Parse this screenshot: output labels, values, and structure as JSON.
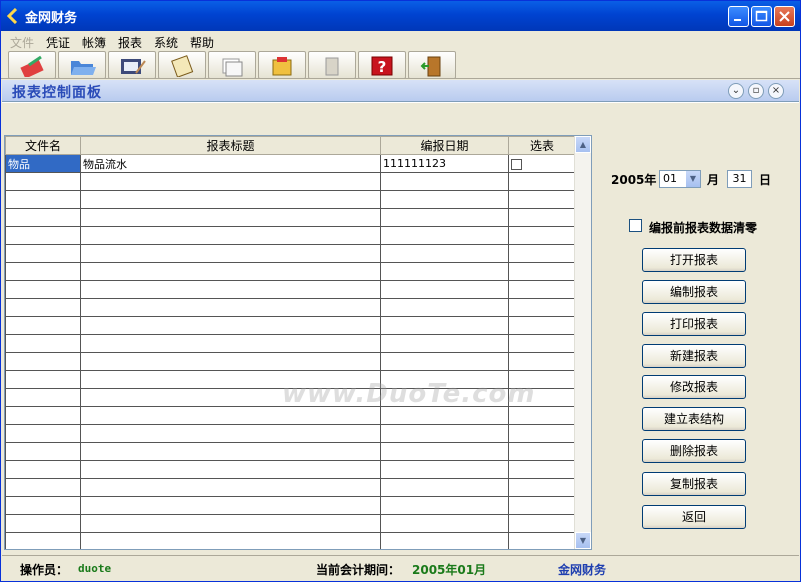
{
  "window": {
    "title": "金网财务"
  },
  "menu": {
    "items": [
      "文件",
      "凭证",
      "帐簿",
      "报表",
      "系统",
      "帮助"
    ]
  },
  "toolbar": {
    "icons": [
      "voucher-icon",
      "folder-open-icon",
      "ledger-icon",
      "notepad-icon",
      "documents-icon",
      "report-icon",
      "book-icon",
      "help-icon",
      "exit-door-icon"
    ]
  },
  "panel": {
    "title": "报表控制面板"
  },
  "table": {
    "columns": [
      "文件名",
      "报表标题",
      "编报日期",
      "选表"
    ],
    "rows": [
      {
        "file": "物品",
        "title": "物品流水",
        "date": "111111123",
        "checked": false
      }
    ],
    "empty_rows": 21
  },
  "date": {
    "year_label": "2005年",
    "month_value": "01",
    "month_label": "月",
    "day_value": "31",
    "day_label": "日"
  },
  "options": {
    "clear_label": "编报前报表数据清零",
    "clear_checked": false
  },
  "buttons": {
    "open": "打开报表",
    "compile": "编制报表",
    "print": "打印报表",
    "new": "新建报表",
    "modify": "修改报表",
    "build": "建立表结构",
    "delete": "删除报表",
    "copy": "复制报表",
    "back": "返回"
  },
  "status": {
    "operator_label": "操作员：",
    "operator": "duote",
    "period_label": "当前会计期间：",
    "period": "2005年01月",
    "app": "金网财务"
  },
  "watermark": "www.DuoTe.com",
  "colors": {
    "title_bar": "#0043d1",
    "selection": "#316ac5",
    "status_value": "#1a7a1a",
    "app_name": "#1f3fb0"
  }
}
